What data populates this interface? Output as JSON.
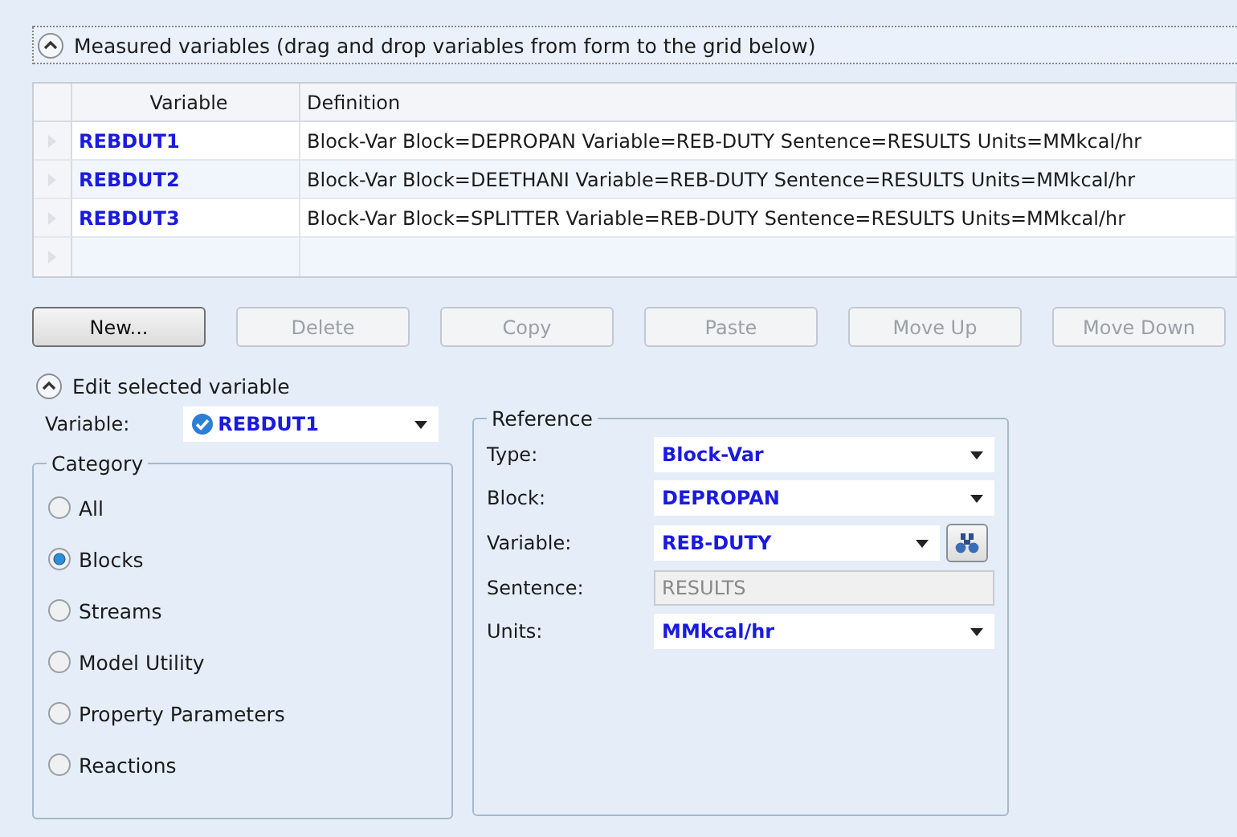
{
  "measured_section": {
    "title": "Measured variables (drag and drop variables from form to the grid below)",
    "expanded": true
  },
  "grid": {
    "columns": [
      "Variable",
      "Definition"
    ],
    "rows": [
      {
        "variable": "REBDUT1",
        "definition": "Block-Var Block=DEPROPAN Variable=REB-DUTY Sentence=RESULTS Units=MMkcal/hr"
      },
      {
        "variable": "REBDUT2",
        "definition": "Block-Var Block=DEETHANI Variable=REB-DUTY Sentence=RESULTS Units=MMkcal/hr"
      },
      {
        "variable": "REBDUT3",
        "definition": "Block-Var Block=SPLITTER Variable=REB-DUTY Sentence=RESULTS Units=MMkcal/hr"
      }
    ]
  },
  "buttons": [
    {
      "label": "New...",
      "disabled": false
    },
    {
      "label": "Delete",
      "disabled": true
    },
    {
      "label": "Copy",
      "disabled": true
    },
    {
      "label": "Paste",
      "disabled": true
    },
    {
      "label": "Move Up",
      "disabled": true
    },
    {
      "label": "Move Down",
      "disabled": true
    }
  ],
  "edit_section": {
    "title": "Edit selected variable",
    "expanded": true
  },
  "variable_select": {
    "label": "Variable:",
    "value": "REBDUT1"
  },
  "category": {
    "title": "Category",
    "options": [
      {
        "label": "All",
        "selected": false
      },
      {
        "label": "Blocks",
        "selected": true
      },
      {
        "label": "Streams",
        "selected": false
      },
      {
        "label": "Model Utility",
        "selected": false
      },
      {
        "label": "Property Parameters",
        "selected": false
      },
      {
        "label": "Reactions",
        "selected": false
      }
    ]
  },
  "reference": {
    "title": "Reference",
    "fields": [
      {
        "label": "Type:",
        "value": "Block-Var",
        "kind": "dropdown"
      },
      {
        "label": "Block:",
        "value": "DEPROPAN",
        "kind": "dropdown"
      },
      {
        "label": "Variable:",
        "value": "REB-DUTY",
        "kind": "dropdown-search"
      },
      {
        "label": "Sentence:",
        "value": "RESULTS",
        "kind": "readonly"
      },
      {
        "label": "Units:",
        "value": "MMkcal/hr",
        "kind": "dropdown"
      }
    ]
  }
}
